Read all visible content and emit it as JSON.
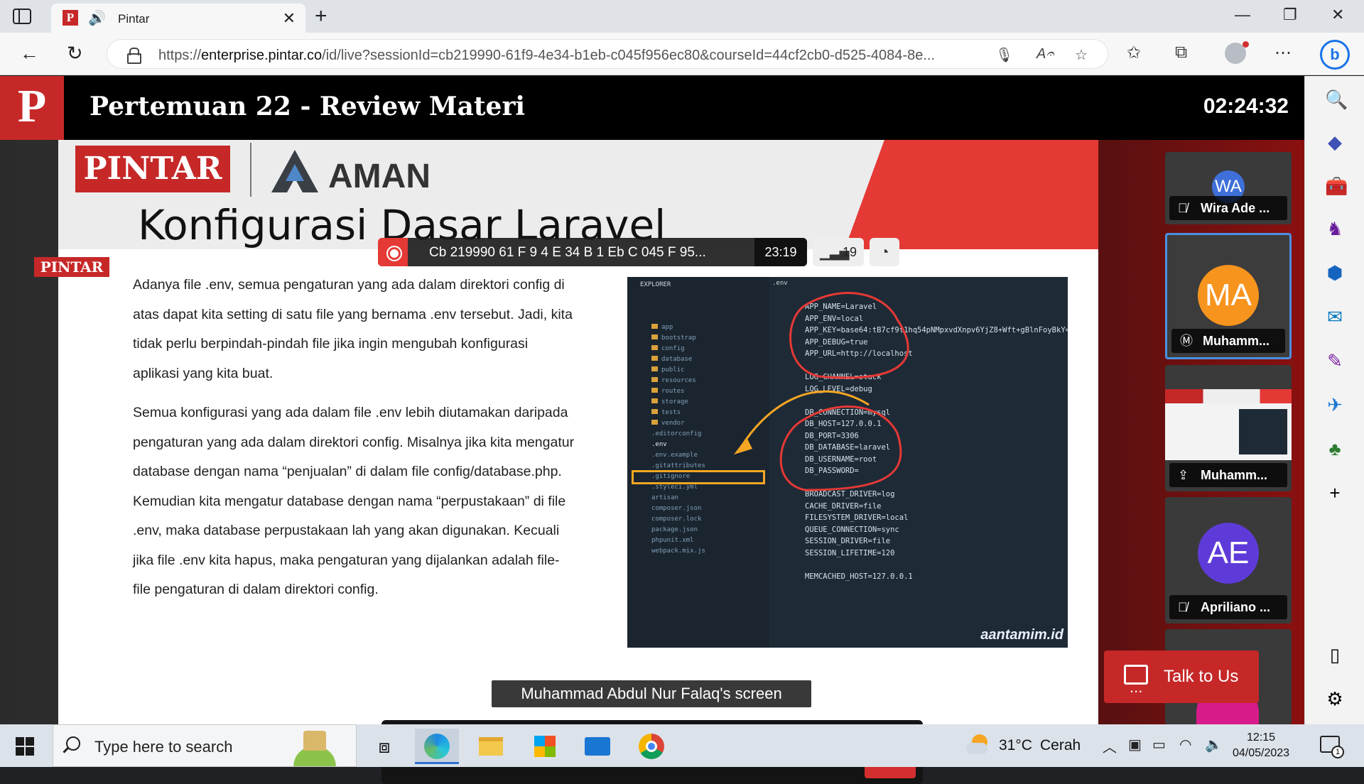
{
  "browser": {
    "tab_title": "Pintar",
    "tab_favicon": "P",
    "url_prefix": "https://",
    "url_domain": "enterprise.pintar.co",
    "url_rest": "/id/live?sessionId=cb219990-61f9-4e34-b1eb-c045f956ec80&courseId=44cf2cb0-d525-4084-8e..."
  },
  "meeting": {
    "logo": "P",
    "title": "Pertemuan 22 - Review Materi",
    "clock": "02:24:32",
    "recording_id": "Cb 219990 61 F 9 4 E 34 B 1 Eb C 045 F 95...",
    "recording_time": "23:19",
    "participant_count": "19",
    "screen_share_label": "Muhammad Abdul Nur Falaq's screen",
    "controls_participants_badge": "19"
  },
  "slide": {
    "brand": "PINTAR",
    "partner": "AMAN",
    "corner_tag": "PINTAR",
    "title": "Konfigurasi Dasar Laravel",
    "para1": "Adanya file .env, semua pengaturan yang ada dalam direktori config di atas dapat kita setting di satu file yang bernama .env tersebut. Jadi, kita tidak perlu berpindah-pindah file jika ingin mengubah konfigurasi aplikasi yang kita buat.",
    "para2": "Semua konfigurasi yang ada dalam file .env lebih diutamakan daripada pengaturan yang ada dalam direktori config. Misalnya jika kita mengatur database dengan nama “penjualan” di dalam file config/database.php. Kemudian kita mengatur database dengan nama “perpustakaan” di file .env, maka database perpustakaan lah yang akan digunakan. Kecuali jika file .env kita hapus, maka pengaturan yang dijalankan adalah file-file pengaturan di dalam direktori config.",
    "code_explorer_head": "EXPLORER",
    "code_tab": ".env",
    "code_env_item": ".env",
    "code_text": "APP_NAME=Laravel\nAPP_ENV=local\nAPP_KEY=base64:tB7cf9t1hq54pNMpxvdXnpv6YjZ8+Wft+gBlnFoyBkY=\nAPP_DEBUG=true\nAPP_URL=http://localhost\n\nLOG_CHANNEL=stack\nLOG_LEVEL=debug\n\nDB_CONNECTION=mysql\nDB_HOST=127.0.0.1\nDB_PORT=3306\nDB_DATABASE=laravel\nDB_USERNAME=root\nDB_PASSWORD=\n\nBROADCAST_DRIVER=log\nCACHE_DRIVER=file\nFILESYSTEM_DRIVER=local\nQUEUE_CONNECTION=sync\nSESSION_DRIVER=file\nSESSION_LIFETIME=120\n\nMEMCACHED_HOST=127.0.0.1",
    "watermark": "aantamim.id",
    "explorer_items": [
      "app",
      "bootstrap",
      "config",
      "database",
      "public",
      "resources",
      "routes",
      "storage",
      "tests",
      "vendor",
      ".editorconfig",
      ".env",
      ".env.example",
      ".gitattributes",
      ".gitignore",
      ".styleci.yml",
      "artisan",
      "composer.json",
      "composer.lock",
      "package.json",
      "phpunit.xml",
      "webpack.mix.js"
    ]
  },
  "participants": [
    {
      "initials": "WA",
      "name": "Wira Ade ...",
      "color": "#3f6fd8",
      "status": "mic-muted-icon"
    },
    {
      "initials": "MA",
      "name": "Muhamm...",
      "color": "#f7941d",
      "status": "host-icon"
    },
    {
      "initials": "",
      "name": "Muhamm...",
      "color": "#3a3a3a",
      "status": "screen-share-icon"
    },
    {
      "initials": "AE",
      "name": "Apriliano ...",
      "color": "#5e3bd8",
      "status": "mic-muted-icon"
    }
  ],
  "talk_button": "Talk to Us",
  "taskbar": {
    "search_placeholder": "Type here to search",
    "weather_temp": "31°C",
    "weather_desc": "Cerah",
    "time": "12:15",
    "date": "04/05/2023",
    "notif_count": "1"
  }
}
